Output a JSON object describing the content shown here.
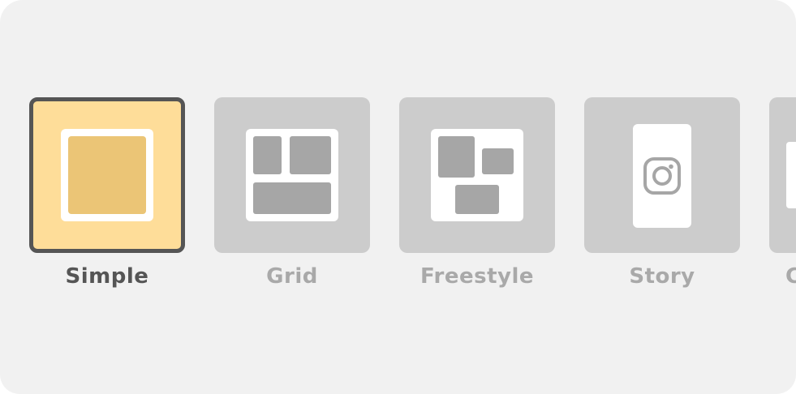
{
  "layout_options": [
    {
      "label": "Simple",
      "selected": true,
      "icon": "simple-layout-icon"
    },
    {
      "label": "Grid",
      "selected": false,
      "icon": "grid-layout-icon"
    },
    {
      "label": "Freestyle",
      "selected": false,
      "icon": "freestyle-layout-icon"
    },
    {
      "label": "Story",
      "selected": false,
      "icon": "instagram-icon"
    },
    {
      "label": "C",
      "selected": false,
      "icon": "partial-layout-icon"
    }
  ],
  "colors": {
    "panel_background": "#f1f1f1",
    "tile_default": "#cccccc",
    "tile_selected": "#fedd99",
    "selected_border": "#555555",
    "accent_fill": "#ebc576",
    "placeholder_block": "#a6a6a6",
    "label_default": "#a9a9a9",
    "label_selected": "#555555"
  }
}
